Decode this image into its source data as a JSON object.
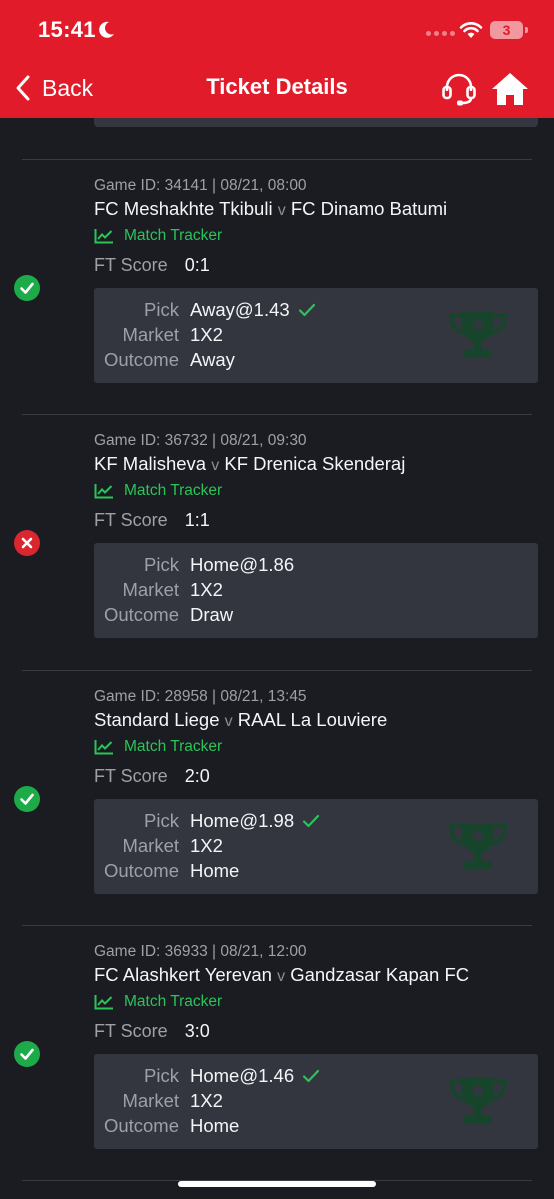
{
  "status_bar": {
    "time": "15:41",
    "battery": "3"
  },
  "nav": {
    "back_label": "Back",
    "title": "Ticket Details"
  },
  "colors": {
    "header": "#e21b2a",
    "background": "#1b1c21",
    "card": "#33363f",
    "won": "#1dab4a",
    "lost": "#d9262f",
    "tracker": "#29c45a"
  },
  "labels": {
    "match_tracker": "Match Tracker",
    "ft_score": "FT Score",
    "pick": "Pick",
    "market": "Market",
    "outcome": "Outcome",
    "versus": "v"
  },
  "games": [
    {
      "meta": "Game ID: 34141 | 08/21, 08:00",
      "home": "FC Meshakhte Tkibuli",
      "away": "FC Dinamo Batumi",
      "score": "0:1",
      "pick": "Away@1.43",
      "market": "1X2",
      "outcome": "Away",
      "result": "won",
      "status_icon": "check-circle-icon"
    },
    {
      "meta": "Game ID: 36732 | 08/21, 09:30",
      "home": "KF Malisheva",
      "away": "KF Drenica Skenderaj",
      "score": "1:1",
      "pick": "Home@1.86",
      "market": "1X2",
      "outcome": "Draw",
      "result": "lost",
      "status_icon": "x-circle-icon"
    },
    {
      "meta": "Game ID: 28958 | 08/21, 13:45",
      "home": "Standard Liege",
      "away": "RAAL La Louviere",
      "score": "2:0",
      "pick": "Home@1.98",
      "market": "1X2",
      "outcome": "Home",
      "result": "won",
      "status_icon": "check-circle-icon"
    },
    {
      "meta": "Game ID: 36933 | 08/21, 12:00",
      "home": "FC Alashkert Yerevan",
      "away": "Gandzasar Kapan FC",
      "score": "3:0",
      "pick": "Home@1.46",
      "market": "1X2",
      "outcome": "Home",
      "result": "won",
      "status_icon": "check-circle-icon"
    }
  ]
}
